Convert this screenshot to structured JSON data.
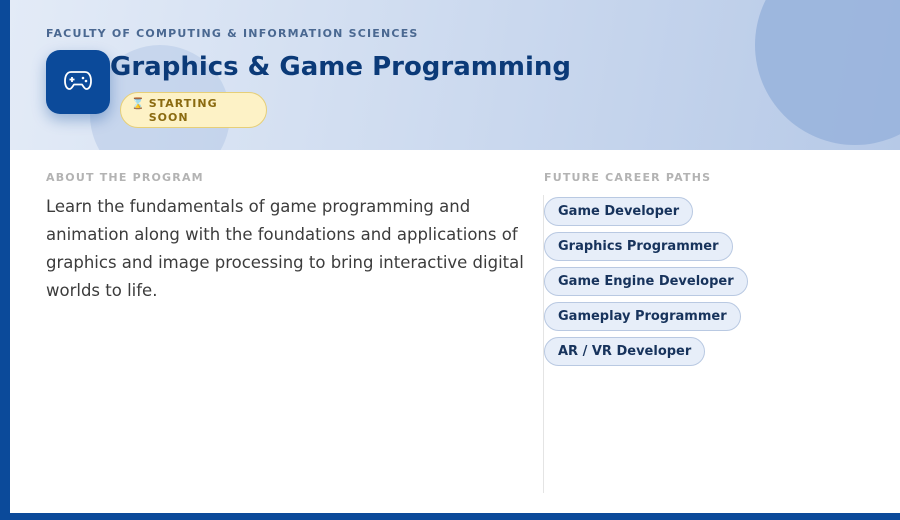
{
  "hero": {
    "faculty": "FACULTY OF COMPUTING & INFORMATION SCIENCES",
    "icon": "gamepad-icon",
    "title": "Graphics & Game Programming",
    "badge": {
      "icon": "hourglass-icon",
      "glyph": "⌛",
      "label": "STARTING SOON"
    }
  },
  "about": {
    "label": "ABOUT THE PROGRAM",
    "text": "Learn the fundamentals of game programming and animation along with the foundations and applications of graphics and image processing to bring interactive digital worlds to life."
  },
  "careers": {
    "label": "FUTURE CAREER PATHS",
    "items": [
      {
        "label": "Game Developer"
      },
      {
        "label": "Graphics Programmer"
      },
      {
        "label": "Game Engine Developer"
      },
      {
        "label": "Gameplay Programmer"
      },
      {
        "label": "AR / VR Developer"
      }
    ]
  },
  "colors": {
    "brand": "#0b4a9a",
    "title": "#0b3a78",
    "badge_bg": "#fdf2c6",
    "chip_bg": "#e7eef9"
  }
}
